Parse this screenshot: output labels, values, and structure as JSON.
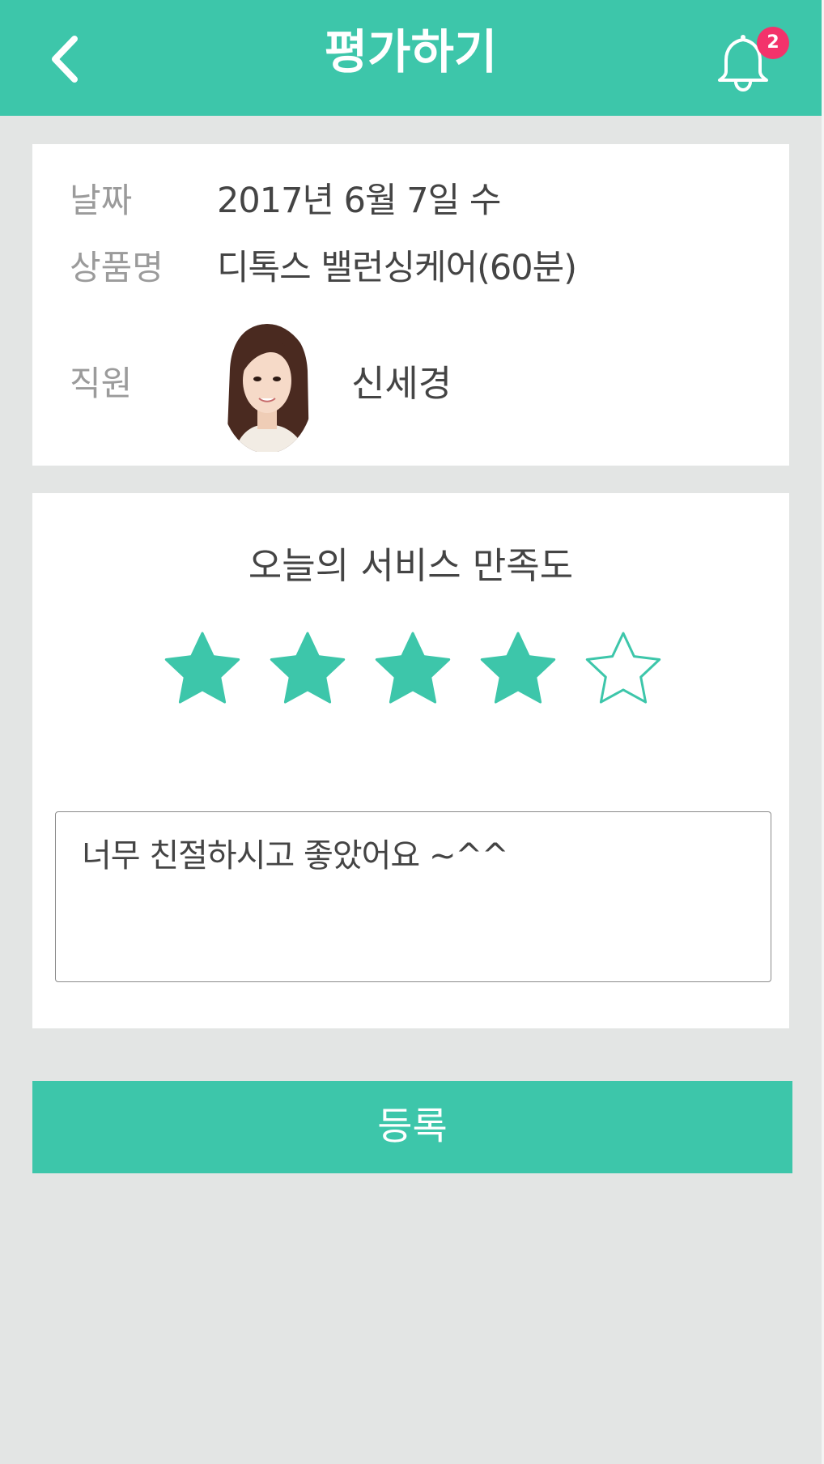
{
  "header": {
    "title": "평가하기",
    "back_icon": "chevron-left-icon",
    "bell_icon": "bell-icon",
    "notification_count": "2"
  },
  "info": {
    "date_label": "날짜",
    "date_value": "2017년 6월 7일 수",
    "product_label": "상품명",
    "product_value": "디톡스 밸런싱케어(60분)",
    "staff_label": "직원",
    "staff_name": "신세경"
  },
  "rating": {
    "title": "오늘의 서비스 만족도",
    "score": 4,
    "max": 5,
    "comment": "너무 친절하시고 좋았어요 ~^^"
  },
  "submit_label": "등록",
  "colors": {
    "accent": "#3dc6aa",
    "badge": "#f3336b",
    "background": "#e3e5e4",
    "text": "#444444",
    "label": "#9b9b9b"
  }
}
